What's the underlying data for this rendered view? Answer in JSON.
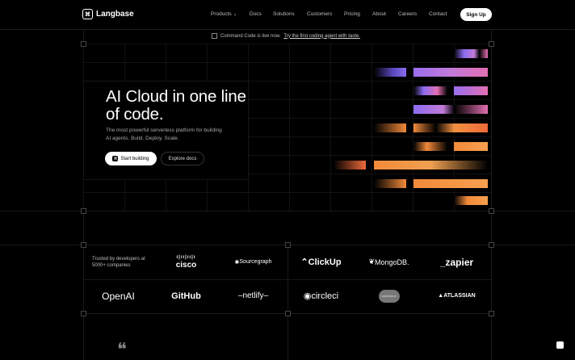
{
  "brand": {
    "name": "Langbase",
    "mark": "⌘"
  },
  "nav": {
    "items": [
      "Products",
      "Docs",
      "Solutions",
      "Customers",
      "Pricing",
      "About",
      "Careers",
      "Contact"
    ],
    "products_chevron": "⌄",
    "signup_label": "Sign Up"
  },
  "announcement": {
    "text": "Command Code is live now.",
    "link": "Try the first coding agent with taste."
  },
  "hero": {
    "title": "AI Cloud in one line of code.",
    "subtitle": "The most powerful serverless platform for building AI agents. Build. Deploy. Scale.",
    "primary_cta": "Start building",
    "secondary_cta": "Explore docs"
  },
  "trusted": {
    "text": "Trusted by developers at 5000+ companies",
    "logos": [
      "cisco",
      "Sourcegraph",
      "ClickUp",
      "MongoDB.",
      "_zapier",
      "OpenAI",
      "GitHub",
      "netlify",
      "circleci",
      "salesforce",
      "ATLASSIAN"
    ]
  },
  "quote_mark": "❝",
  "colors": {
    "purple": "#8b6cf0",
    "pink": "#e36fb3",
    "orange": "#f28a3a",
    "background": "#000000"
  }
}
